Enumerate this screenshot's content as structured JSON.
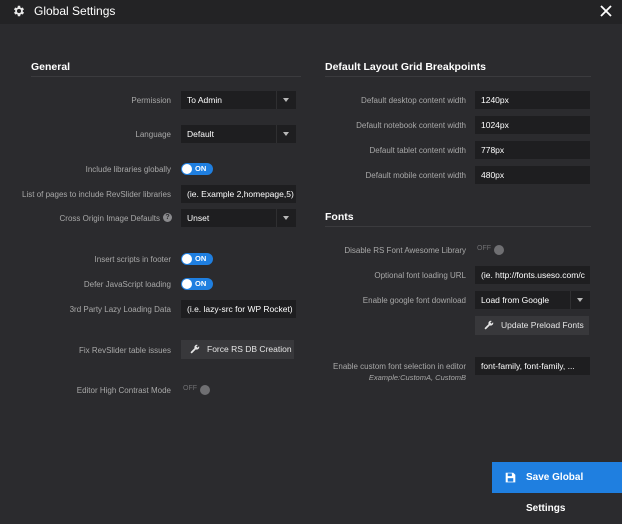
{
  "window": {
    "title": "Global Settings"
  },
  "general": {
    "title": "General",
    "permission": {
      "label": "Permission",
      "value": "To Admin"
    },
    "language": {
      "label": "Language",
      "value": "Default"
    },
    "include_libraries": {
      "label": "Include libraries globally",
      "state": "ON"
    },
    "pages_list": {
      "label": "List of pages to include RevSlider libraries",
      "value": "(ie. Example 2,homepage,5)"
    },
    "cross_origin": {
      "label": "Cross Origin Image Defaults",
      "value": "Unset",
      "help": "?"
    },
    "insert_footer": {
      "label": "Insert scripts in footer",
      "state": "ON"
    },
    "defer_js": {
      "label": "Defer JavaScript loading",
      "state": "ON"
    },
    "lazy_loading": {
      "label": "3rd Party Lazy Loading Data",
      "value": "(i.e. lazy-src for WP Rocket)"
    },
    "fix_tables": {
      "label": "Fix RevSlider table issues",
      "button": "Force RS DB Creation"
    },
    "high_contrast": {
      "label": "Editor High Contrast Mode",
      "state": "OFF"
    }
  },
  "breakpoints": {
    "title": "Default Layout Grid Breakpoints",
    "desktop": {
      "label": "Default desktop content width",
      "value": "1240px"
    },
    "notebook": {
      "label": "Default notebook content width",
      "value": "1024px"
    },
    "tablet": {
      "label": "Default tablet content width",
      "value": "778px"
    },
    "mobile": {
      "label": "Default mobile content width",
      "value": "480px"
    }
  },
  "fonts": {
    "title": "Fonts",
    "disable_fa": {
      "label": "Disable RS Font Awesome Library",
      "state": "OFF"
    },
    "font_url": {
      "label": "Optional font loading URL",
      "value": "(ie. http://fonts.useso.com/c"
    },
    "google_download": {
      "label": "Enable google font download",
      "value": "Load from Google"
    },
    "update_preload": {
      "button": "Update Preload Fonts"
    },
    "custom_font": {
      "label": "Enable custom font selection in editor",
      "sublabel": "Example:CustomA, CustomB",
      "value": "font-family, font-family, ..."
    }
  },
  "save": {
    "label": "Save Global Settings"
  },
  "colors": {
    "accent": "#1f7fe0",
    "background": "#2b2b2e",
    "titlebar": "#232325"
  }
}
